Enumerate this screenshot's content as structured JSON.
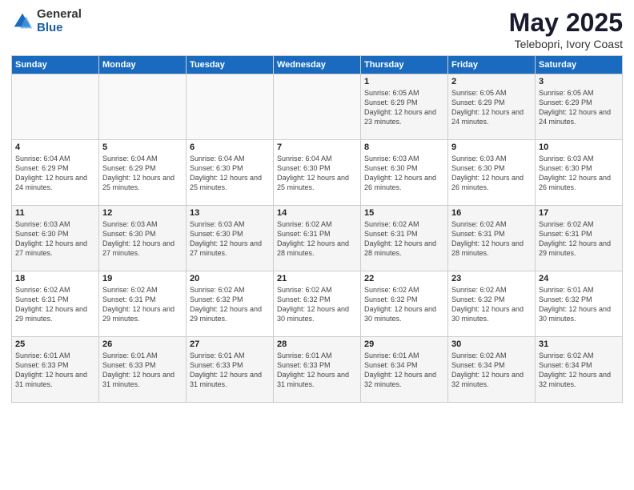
{
  "logo": {
    "general": "General",
    "blue": "Blue"
  },
  "title": "May 2025",
  "subtitle": "Telebopri, Ivory Coast",
  "days_header": [
    "Sunday",
    "Monday",
    "Tuesday",
    "Wednesday",
    "Thursday",
    "Friday",
    "Saturday"
  ],
  "weeks": [
    [
      {
        "num": "",
        "sunrise": "",
        "sunset": "",
        "daylight": ""
      },
      {
        "num": "",
        "sunrise": "",
        "sunset": "",
        "daylight": ""
      },
      {
        "num": "",
        "sunrise": "",
        "sunset": "",
        "daylight": ""
      },
      {
        "num": "",
        "sunrise": "",
        "sunset": "",
        "daylight": ""
      },
      {
        "num": "1",
        "sunrise": "Sunrise: 6:05 AM",
        "sunset": "Sunset: 6:29 PM",
        "daylight": "Daylight: 12 hours and 23 minutes."
      },
      {
        "num": "2",
        "sunrise": "Sunrise: 6:05 AM",
        "sunset": "Sunset: 6:29 PM",
        "daylight": "Daylight: 12 hours and 24 minutes."
      },
      {
        "num": "3",
        "sunrise": "Sunrise: 6:05 AM",
        "sunset": "Sunset: 6:29 PM",
        "daylight": "Daylight: 12 hours and 24 minutes."
      }
    ],
    [
      {
        "num": "4",
        "sunrise": "Sunrise: 6:04 AM",
        "sunset": "Sunset: 6:29 PM",
        "daylight": "Daylight: 12 hours and 24 minutes."
      },
      {
        "num": "5",
        "sunrise": "Sunrise: 6:04 AM",
        "sunset": "Sunset: 6:29 PM",
        "daylight": "Daylight: 12 hours and 25 minutes."
      },
      {
        "num": "6",
        "sunrise": "Sunrise: 6:04 AM",
        "sunset": "Sunset: 6:30 PM",
        "daylight": "Daylight: 12 hours and 25 minutes."
      },
      {
        "num": "7",
        "sunrise": "Sunrise: 6:04 AM",
        "sunset": "Sunset: 6:30 PM",
        "daylight": "Daylight: 12 hours and 25 minutes."
      },
      {
        "num": "8",
        "sunrise": "Sunrise: 6:03 AM",
        "sunset": "Sunset: 6:30 PM",
        "daylight": "Daylight: 12 hours and 26 minutes."
      },
      {
        "num": "9",
        "sunrise": "Sunrise: 6:03 AM",
        "sunset": "Sunset: 6:30 PM",
        "daylight": "Daylight: 12 hours and 26 minutes."
      },
      {
        "num": "10",
        "sunrise": "Sunrise: 6:03 AM",
        "sunset": "Sunset: 6:30 PM",
        "daylight": "Daylight: 12 hours and 26 minutes."
      }
    ],
    [
      {
        "num": "11",
        "sunrise": "Sunrise: 6:03 AM",
        "sunset": "Sunset: 6:30 PM",
        "daylight": "Daylight: 12 hours and 27 minutes."
      },
      {
        "num": "12",
        "sunrise": "Sunrise: 6:03 AM",
        "sunset": "Sunset: 6:30 PM",
        "daylight": "Daylight: 12 hours and 27 minutes."
      },
      {
        "num": "13",
        "sunrise": "Sunrise: 6:03 AM",
        "sunset": "Sunset: 6:30 PM",
        "daylight": "Daylight: 12 hours and 27 minutes."
      },
      {
        "num": "14",
        "sunrise": "Sunrise: 6:02 AM",
        "sunset": "Sunset: 6:31 PM",
        "daylight": "Daylight: 12 hours and 28 minutes."
      },
      {
        "num": "15",
        "sunrise": "Sunrise: 6:02 AM",
        "sunset": "Sunset: 6:31 PM",
        "daylight": "Daylight: 12 hours and 28 minutes."
      },
      {
        "num": "16",
        "sunrise": "Sunrise: 6:02 AM",
        "sunset": "Sunset: 6:31 PM",
        "daylight": "Daylight: 12 hours and 28 minutes."
      },
      {
        "num": "17",
        "sunrise": "Sunrise: 6:02 AM",
        "sunset": "Sunset: 6:31 PM",
        "daylight": "Daylight: 12 hours and 29 minutes."
      }
    ],
    [
      {
        "num": "18",
        "sunrise": "Sunrise: 6:02 AM",
        "sunset": "Sunset: 6:31 PM",
        "daylight": "Daylight: 12 hours and 29 minutes."
      },
      {
        "num": "19",
        "sunrise": "Sunrise: 6:02 AM",
        "sunset": "Sunset: 6:31 PM",
        "daylight": "Daylight: 12 hours and 29 minutes."
      },
      {
        "num": "20",
        "sunrise": "Sunrise: 6:02 AM",
        "sunset": "Sunset: 6:32 PM",
        "daylight": "Daylight: 12 hours and 29 minutes."
      },
      {
        "num": "21",
        "sunrise": "Sunrise: 6:02 AM",
        "sunset": "Sunset: 6:32 PM",
        "daylight": "Daylight: 12 hours and 30 minutes."
      },
      {
        "num": "22",
        "sunrise": "Sunrise: 6:02 AM",
        "sunset": "Sunset: 6:32 PM",
        "daylight": "Daylight: 12 hours and 30 minutes."
      },
      {
        "num": "23",
        "sunrise": "Sunrise: 6:02 AM",
        "sunset": "Sunset: 6:32 PM",
        "daylight": "Daylight: 12 hours and 30 minutes."
      },
      {
        "num": "24",
        "sunrise": "Sunrise: 6:01 AM",
        "sunset": "Sunset: 6:32 PM",
        "daylight": "Daylight: 12 hours and 30 minutes."
      }
    ],
    [
      {
        "num": "25",
        "sunrise": "Sunrise: 6:01 AM",
        "sunset": "Sunset: 6:33 PM",
        "daylight": "Daylight: 12 hours and 31 minutes."
      },
      {
        "num": "26",
        "sunrise": "Sunrise: 6:01 AM",
        "sunset": "Sunset: 6:33 PM",
        "daylight": "Daylight: 12 hours and 31 minutes."
      },
      {
        "num": "27",
        "sunrise": "Sunrise: 6:01 AM",
        "sunset": "Sunset: 6:33 PM",
        "daylight": "Daylight: 12 hours and 31 minutes."
      },
      {
        "num": "28",
        "sunrise": "Sunrise: 6:01 AM",
        "sunset": "Sunset: 6:33 PM",
        "daylight": "Daylight: 12 hours and 31 minutes."
      },
      {
        "num": "29",
        "sunrise": "Sunrise: 6:01 AM",
        "sunset": "Sunset: 6:34 PM",
        "daylight": "Daylight: 12 hours and 32 minutes."
      },
      {
        "num": "30",
        "sunrise": "Sunrise: 6:02 AM",
        "sunset": "Sunset: 6:34 PM",
        "daylight": "Daylight: 12 hours and 32 minutes."
      },
      {
        "num": "31",
        "sunrise": "Sunrise: 6:02 AM",
        "sunset": "Sunset: 6:34 PM",
        "daylight": "Daylight: 12 hours and 32 minutes."
      }
    ]
  ]
}
